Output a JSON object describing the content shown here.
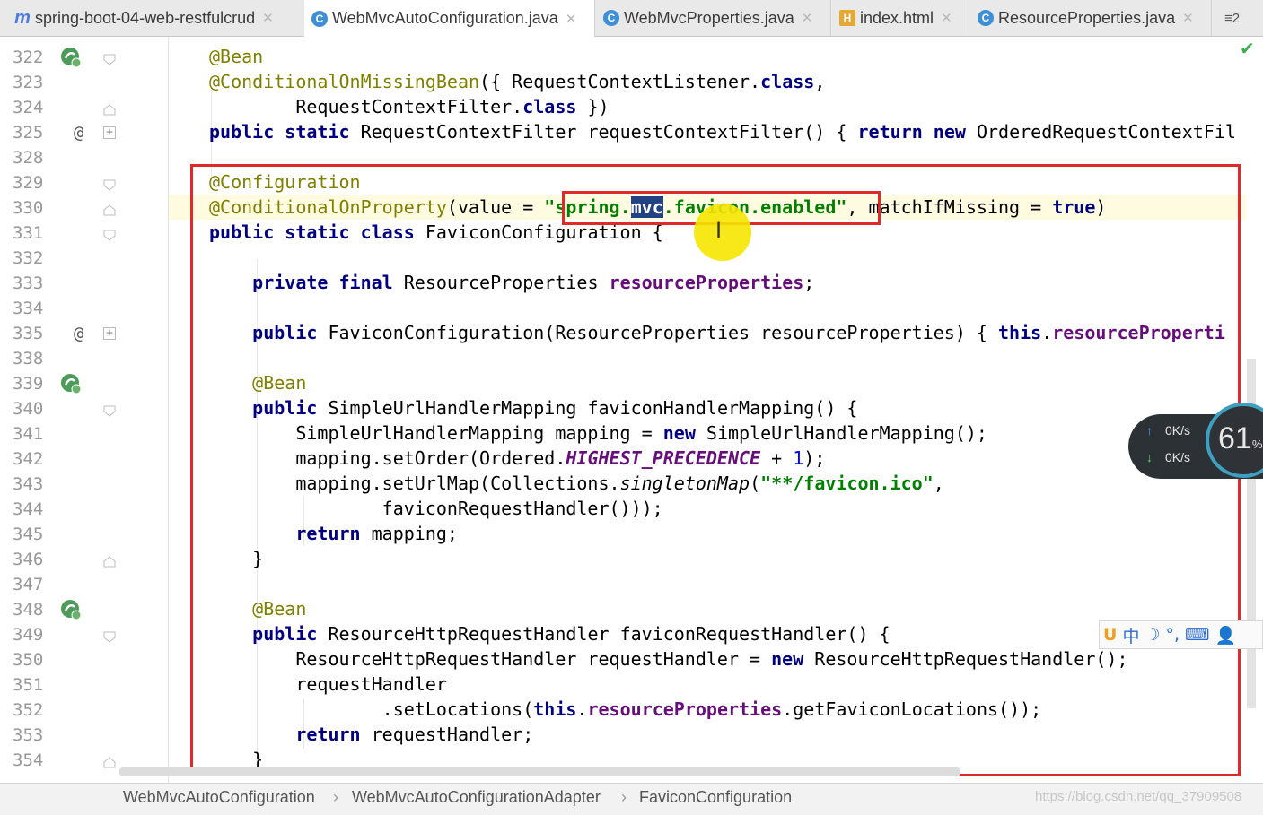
{
  "tabs": [
    {
      "label": "spring-boot-04-web-restfulcrud",
      "icon": "module-icon",
      "active": false
    },
    {
      "label": "WebMvcAutoConfiguration.java",
      "icon": "class-icon",
      "active": true
    },
    {
      "label": "WebMvcProperties.java",
      "icon": "class-icon",
      "active": false
    },
    {
      "label": "index.html",
      "icon": "html-icon",
      "active": false
    },
    {
      "label": "ResourceProperties.java",
      "icon": "class-icon",
      "active": false
    }
  ],
  "tab_overflow_label": "≡2",
  "line_numbers": [
    "322",
    "323",
    "324",
    "325",
    "328",
    "329",
    "330",
    "331",
    "332",
    "333",
    "334",
    "335",
    "338",
    "339",
    "340",
    "341",
    "342",
    "343",
    "344",
    "345",
    "346",
    "347",
    "348",
    "349",
    "350",
    "351",
    "352",
    "353",
    "354"
  ],
  "code": {
    "l322": "@Bean",
    "l323_a": "@ConditionalOnMissingBean",
    "l323_b": "({ RequestContextListener.",
    "l323_c": "class",
    "l323_d": ",",
    "l324_a": "        RequestContextFilter.",
    "l324_b": "class",
    "l324_c": " })",
    "l325_a": "public static",
    "l325_b": " RequestContextFilter requestContextFilter() { ",
    "l325_c": "return new",
    "l325_d": " OrderedRequestContextFil",
    "l329": "@Configuration",
    "l330_a": "@ConditionalOnProperty",
    "l330_b": "(value = ",
    "l330_c": "\"spring.",
    "l330_d": "mvc",
    "l330_e": ".favicon.enabled\"",
    "l330_f": ", matchIfMissing = ",
    "l330_g": "true",
    "l330_h": ")",
    "l331_a": "public static class",
    "l331_b": " FaviconConfiguration {",
    "l333_a": "    private final",
    "l333_b": " ResourceProperties ",
    "l333_c": "resourceProperties",
    "l333_d": ";",
    "l335_a": "    public",
    "l335_b": " FaviconConfiguration(ResourceProperties resourceProperties) { ",
    "l335_c": "this",
    "l335_d": ".",
    "l335_e": "resourceProperti",
    "l339": "    @Bean",
    "l340_a": "    public",
    "l340_b": " SimpleUrlHandlerMapping faviconHandlerMapping() {",
    "l341_a": "        SimpleUrlHandlerMapping mapping = ",
    "l341_b": "new",
    "l341_c": " SimpleUrlHandlerMapping();",
    "l342_a": "        mapping.setOrder(Ordered.",
    "l342_b": "HIGHEST_PRECEDENCE",
    "l342_c": " + ",
    "l342_d": "1",
    "l342_e": ");",
    "l343_a": "        mapping.setUrlMap(Collections.",
    "l343_b": "singletonMap",
    "l343_c": "(",
    "l343_d": "\"**/favicon.ico\"",
    "l343_e": ",",
    "l344": "                faviconRequestHandler()));",
    "l345_a": "        return",
    "l345_b": " mapping;",
    "l346": "    }",
    "l348": "    @Bean",
    "l349_a": "    public",
    "l349_b": " ResourceHttpRequestHandler faviconRequestHandler() {",
    "l350_a": "        ResourceHttpRequestHandler requestHandler = ",
    "l350_b": "new",
    "l350_c": " ResourceHttpRequestHandler();",
    "l351": "        requestHandler",
    "l352_a": "                .setLocations(",
    "l352_b": "this",
    "l352_c": ".",
    "l352_d": "resourceProperties",
    "l352_e": ".getFaviconLocations());",
    "l353_a": "        return",
    "l353_b": " requestHandler;",
    "l354": "    }"
  },
  "net_widget": {
    "up": "0K/s",
    "down": "0K/s",
    "percent": "61",
    "percent_sign": "%"
  },
  "ime_bar": [
    "中",
    "☽",
    "°,",
    "⌨",
    "👤"
  ],
  "breadcrumbs": [
    "WebMvcAutoConfiguration",
    "WebMvcAutoConfigurationAdapter",
    "FaviconConfiguration"
  ],
  "breadcrumb_sep": "›",
  "watermark": "https://blog.csdn.net/qq_37909508",
  "colors": {
    "keyword": "#000080",
    "annotation": "#808000",
    "string": "#008000",
    "field": "#660e7a",
    "highlight_box": "#e02a2a",
    "selection": "#214283"
  }
}
